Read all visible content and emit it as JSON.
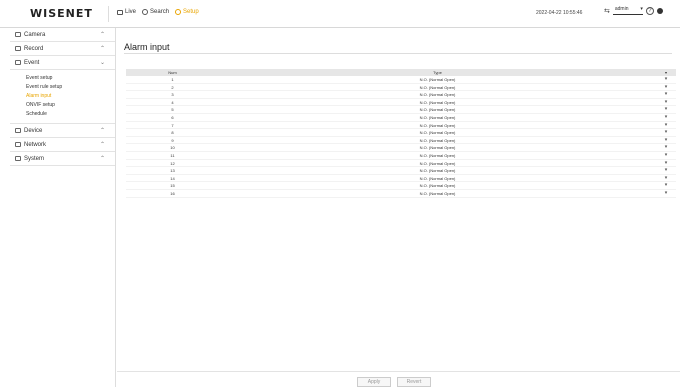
{
  "header": {
    "logo": "WISENET",
    "nav": [
      {
        "label": "Live",
        "icon": "monitor-icon"
      },
      {
        "label": "Search",
        "icon": "search-icon"
      },
      {
        "label": "Setup",
        "icon": "gear-icon"
      }
    ],
    "datetime": "2022-04-22 10:55:46",
    "user": "admin",
    "accent_color": "#e9a500"
  },
  "sidebar": {
    "sections": [
      {
        "label": "Camera",
        "icon": "camera-icon"
      },
      {
        "label": "Record",
        "icon": "record-icon"
      },
      {
        "label": "Event",
        "icon": "event-icon"
      },
      {
        "label": "Device",
        "icon": "device-icon"
      },
      {
        "label": "Network",
        "icon": "network-icon"
      },
      {
        "label": "System",
        "icon": "system-icon"
      }
    ],
    "event_items": [
      "Event setup",
      "Event rule setup",
      "Alarm input",
      "ONVIF setup",
      "Schedule"
    ]
  },
  "main": {
    "title": "Alarm input",
    "table": {
      "headers": [
        "Num",
        "Type"
      ],
      "rows": [
        {
          "num": "1",
          "type": "N.O. (Normal Open)"
        },
        {
          "num": "2",
          "type": "N.O. (Normal Open)"
        },
        {
          "num": "3",
          "type": "N.O. (Normal Open)"
        },
        {
          "num": "4",
          "type": "N.O. (Normal Open)"
        },
        {
          "num": "5",
          "type": "N.O. (Normal Open)"
        },
        {
          "num": "6",
          "type": "N.O. (Normal Open)"
        },
        {
          "num": "7",
          "type": "N.O. (Normal Open)"
        },
        {
          "num": "8",
          "type": "N.O. (Normal Open)"
        },
        {
          "num": "9",
          "type": "N.O. (Normal Open)"
        },
        {
          "num": "10",
          "type": "N.O. (Normal Open)"
        },
        {
          "num": "11",
          "type": "N.O. (Normal Open)"
        },
        {
          "num": "12",
          "type": "N.O. (Normal Open)"
        },
        {
          "num": "13",
          "type": "N.O. (Normal Open)"
        },
        {
          "num": "14",
          "type": "N.O. (Normal Open)"
        },
        {
          "num": "15",
          "type": "N.O. (Normal Open)"
        },
        {
          "num": "16",
          "type": "N.O. (Normal Open)"
        }
      ]
    },
    "apply_label": "Apply",
    "revert_label": "Revert"
  }
}
